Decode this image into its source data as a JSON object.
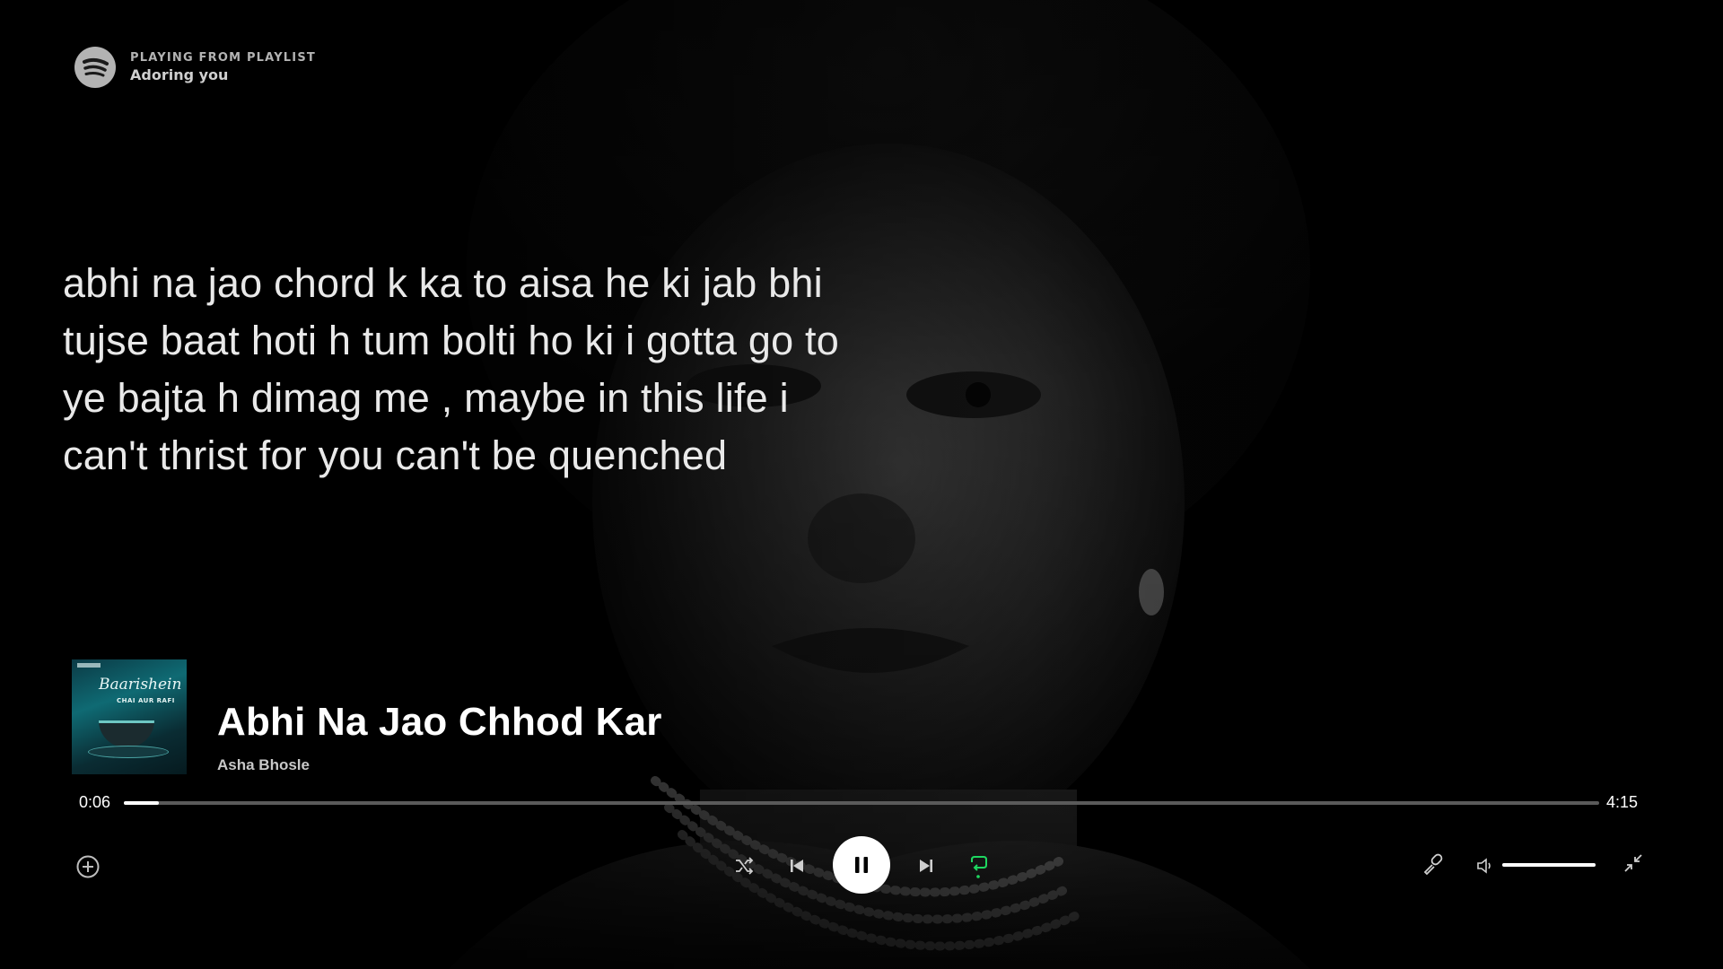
{
  "header": {
    "kicker": "PLAYING FROM PLAYLIST",
    "playlist_name": "Adoring you",
    "logo_icon": "spotify-logo-icon"
  },
  "lyrics": {
    "lines": [
      " abhi na jao chord k ka to aisa he ki jab bhi",
      "tujse baat hoti h tum bolti ho ki i gotta go to",
      "ye bajta h dimag me , maybe in this life i",
      "can't thrist for you can't be quenched"
    ]
  },
  "now_playing": {
    "title": "Abhi Na Jao Chhod Kar",
    "artist": "Asha Bhosle",
    "cover": {
      "title": "Baarishein",
      "subtitle": "CHAI AUR RAFI"
    }
  },
  "playback": {
    "elapsed": "0:06",
    "duration": "4:15",
    "progress_fraction": 0.024,
    "state": "playing",
    "repeat_active": true,
    "volume_fraction": 1.0
  },
  "controls": {
    "add": "plus-circle-icon",
    "shuffle": "shuffle-icon",
    "previous": "skip-previous-icon",
    "play_pause": "pause-icon",
    "next": "skip-next-icon",
    "repeat": "repeat-icon",
    "lyrics": "microphone-icon",
    "volume": "volume-icon",
    "collapse": "collapse-icon"
  },
  "colors": {
    "accent": "#1ed760",
    "text_primary": "#ffffff",
    "text_secondary": "#b3b3b3",
    "track_bg": "#5a5a5a"
  }
}
